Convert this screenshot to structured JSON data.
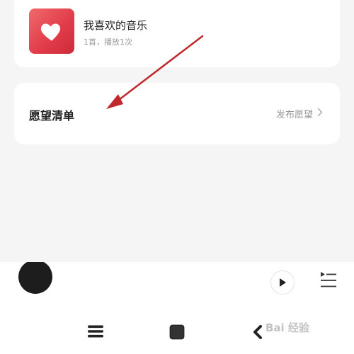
{
  "favorites": {
    "title": "我喜欢的音乐",
    "subtitle": "1首，播放1次",
    "icon": "heart-icon"
  },
  "wishlist": {
    "title": "愿望清单",
    "action_label": "发布愿望",
    "action_icon": "chevron-right-icon"
  },
  "player": {
    "play_icon": "play-icon",
    "playlist_icon": "playlist-icon"
  },
  "navbar": {
    "menu_icon": "menu-icon",
    "home_icon": "home-icon",
    "back_icon": "back-icon"
  },
  "watermark": {
    "text": "Bai 经验"
  },
  "colors": {
    "background": "#f5f5f5",
    "card": "#ffffff",
    "cover_red": "#e23d4a",
    "arrow_red": "#c0282c",
    "muted_text": "#999999"
  }
}
